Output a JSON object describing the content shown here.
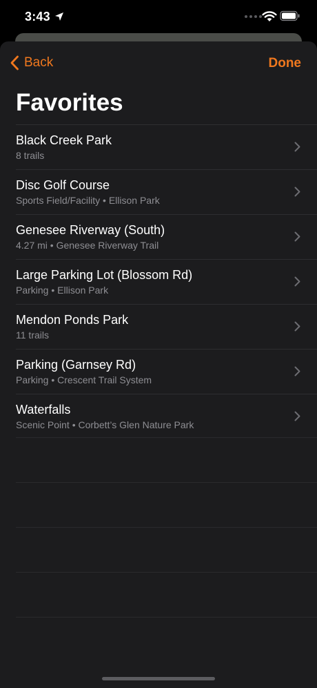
{
  "status_bar": {
    "time": "3:43"
  },
  "nav": {
    "back_label": "Back",
    "done_label": "Done"
  },
  "page": {
    "title": "Favorites"
  },
  "favorites": [
    {
      "title": "Black Creek Park",
      "subtitle": "8 trails"
    },
    {
      "title": "Disc Golf Course",
      "subtitle": "Sports Field/Facility • Ellison Park"
    },
    {
      "title": "Genesee Riverway (South)",
      "subtitle": "4.27 mi • Genesee Riverway Trail"
    },
    {
      "title": "Large Parking Lot (Blossom Rd)",
      "subtitle": "Parking • Ellison Park"
    },
    {
      "title": "Mendon Ponds Park",
      "subtitle": "11 trails"
    },
    {
      "title": "Parking (Garnsey Rd)",
      "subtitle": "Parking • Crescent Trail System"
    },
    {
      "title": "Waterfalls",
      "subtitle": "Scenic Point • Corbett’s Glen Nature Park"
    }
  ],
  "icons": {
    "back": "chevron-left-icon",
    "row": "chevron-right-icon",
    "location": "location-arrow-icon",
    "wifi": "wifi-icon",
    "battery": "battery-icon"
  },
  "colors": {
    "accent": "#f0781e",
    "sheet_background": "#1c1c1e",
    "secondary_text": "#8e8e93"
  }
}
